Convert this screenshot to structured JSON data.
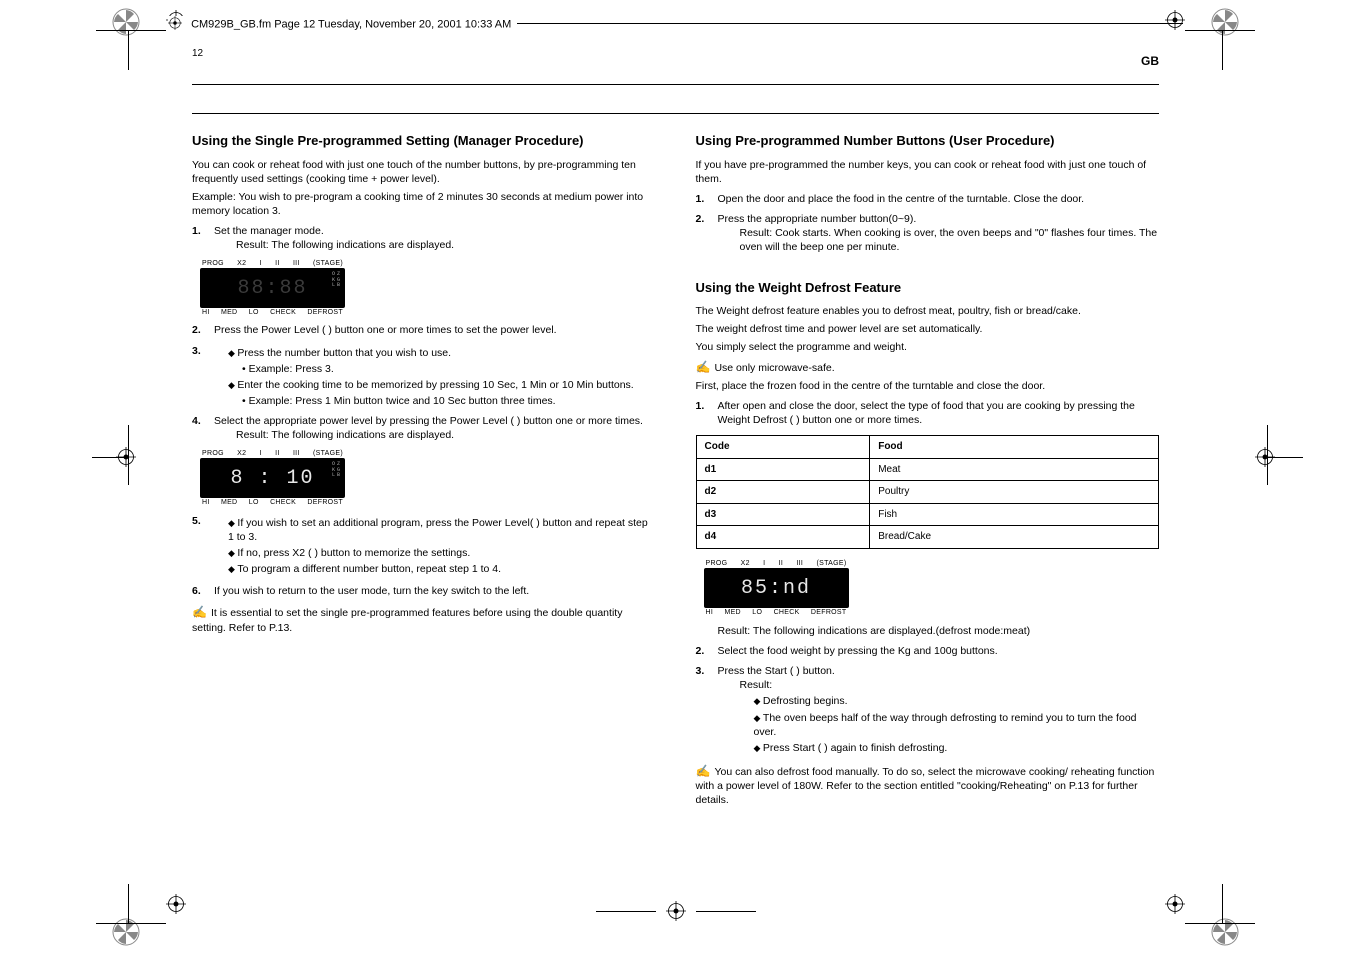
{
  "file_header": "CM929B_GB.fm  Page 12  Tuesday, November 20, 2001  10:33 AM",
  "page_number": "12",
  "gb_label": "GB",
  "display_labels": {
    "top": [
      "PROG",
      "X2",
      "I",
      "II",
      "III",
      "(STAGE)"
    ],
    "bottom": [
      "HI",
      "MED",
      "LO",
      "CHECK",
      "DEFROST"
    ],
    "side": [
      "OZ",
      "KG",
      "LB"
    ]
  },
  "lcd_values": {
    "blank": "88:88",
    "ten": "8 : 10",
    "defrost": "85:nd"
  },
  "left": {
    "h1": "Using the Single Pre-programmed Setting (Manager Procedure)",
    "p1": "You can cook or reheat food with just one touch of the number buttons, by pre-programming ten frequently used settings (cooking time + power level).",
    "p2": "Example: You wish to pre-program a cooking time of 2 minutes 30 seconds at medium power into memory location 3.",
    "step1": "Set the manager mode.",
    "result1": "Result: The following indications are displayed.",
    "step2": "Press the Power Level (          ) button one or more times to set the power level.",
    "step3_a": "Press the number button that you wish to use.",
    "step3_example": "Example: Press 3.",
    "step3_b": "Enter the cooking time to be memorized by pressing 10 Sec, 1 Min or 10 Min buttons.",
    "step3_example2": "Example: Press 1 Min button twice and 10 Sec button three times.",
    "step4": "Select the appropriate power level by pressing the Power Level (          ) button one or more times.",
    "result4": "Result: The following indications are displayed.",
    "step5_a": "If you wish to set an additional program, press the Power Level(         ) button and repeat step 1 to 3.",
    "step5_b": "If no, press X2 (        ) button to memorize the settings.",
    "step5_c": "To program a different number button, repeat step 1 to 4.",
    "step6": "If you wish to return to the user mode, turn the key switch to the left.",
    "note": "It is essential to set the single pre-programmed features before using the double quantity setting. Refer to P.13."
  },
  "right": {
    "h1": "Using Pre-programmed Number Buttons (User Procedure)",
    "p1": "If you have pre-programmed the number keys, you can cook or reheat food with just one touch of them.",
    "step1": "Open the door and place the food in the centre of the turntable. Close the door.",
    "step2": "Press the appropriate number button(0~9).",
    "result2": "Result: Cook starts. When cooking is over, the oven beeps and \"0\" flashes four times. The oven will the beep one per minute.",
    "h2": "Using the Weight Defrost Feature",
    "p2a": "The Weight defrost feature enables you to defrost meat, poultry, fish or bread/cake.",
    "p2b": "The weight defrost time and power level are set automatically.",
    "p2c": "You simply select the programme and weight.",
    "note2": "Use only microwave-safe.",
    "p3": "First, place the frozen food in the centre of the turntable and close the door.",
    "step_r1": "After open and close the door, select the type of food that you are cooking by pressing the Weight Defrost (       ) button one or more times.",
    "table_h1": "Code",
    "table_h2": "Food",
    "rows": [
      {
        "code": "d1",
        "food": "Meat"
      },
      {
        "code": "d2",
        "food": "Poultry"
      },
      {
        "code": "d3",
        "food": "Fish"
      },
      {
        "code": "d4",
        "food": "Bread/Cake"
      }
    ],
    "result_r1": "Result: The following indications are displayed.(defrost mode:meat)",
    "step_r2": "Select the food weight by pressing the Kg and 100g buttons.",
    "step_r3": "Press the Start (       ) button.",
    "result_r3a": "Result:",
    "result_r3b": "Defrosting begins.",
    "result_r3c": "The oven beeps half of the way through defrosting to remind you to turn the food over.",
    "result_r3d": "Press Start (       ) again to finish defrosting.",
    "note3": "You can also defrost food manually. To do so, select the microwave cooking/ reheating function with a power level of 180W. Refer to the section entitled \"cooking/Reheating\" on P.13 for further details."
  }
}
